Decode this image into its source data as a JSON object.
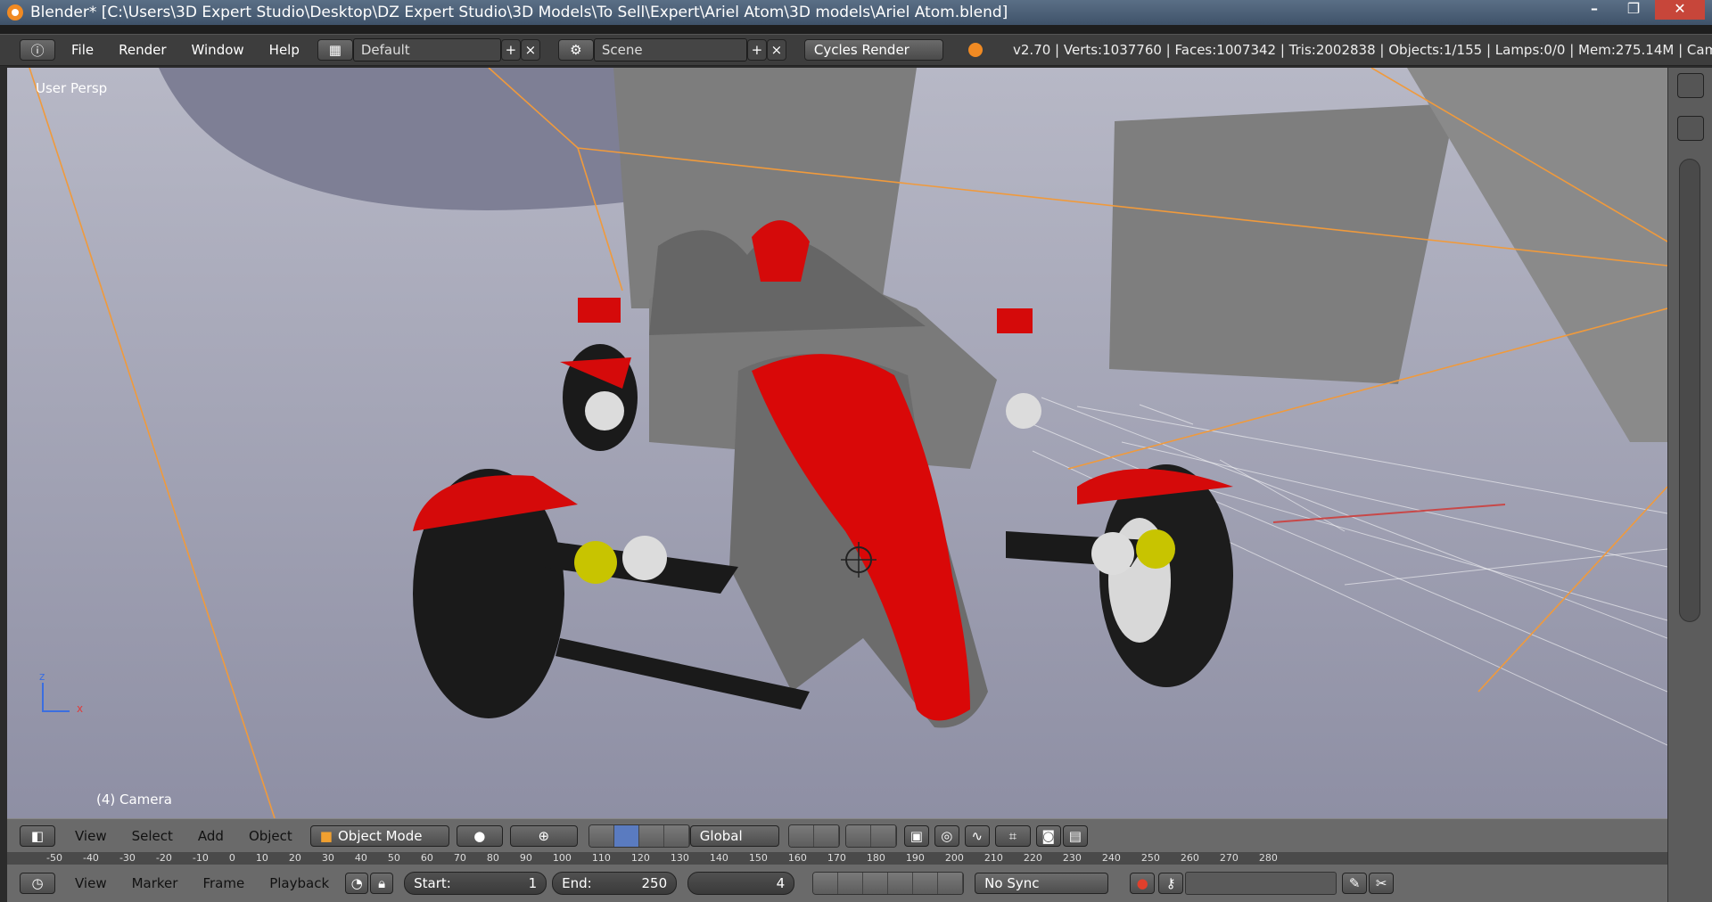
{
  "window": {
    "title": "Blender* [C:\\Users\\3D Expert Studio\\Desktop\\DZ Expert Studio\\3D Models\\To Sell\\Expert\\Ariel Atom\\3D models\\Ariel Atom.blend]",
    "min": "–",
    "max": "❐",
    "close": "✕"
  },
  "info_header": {
    "menus": [
      "File",
      "Render",
      "Window",
      "Help"
    ],
    "layout": "Default",
    "scene": "Scene",
    "engine": "Cycles Render",
    "stats": "v2.70 | Verts:1037760 | Faces:1007342 | Tris:2002838 | Objects:1/155 | Lamps:0/0 | Mem:275.14M | Came",
    "add": "+",
    "remove": "×"
  },
  "viewport": {
    "view_name": "User Persp",
    "active_object": "(4) Camera",
    "axis_z": "z",
    "axis_x": "x"
  },
  "view3d_header": {
    "menus": [
      "View",
      "Select",
      "Add",
      "Object"
    ],
    "mode": "Object Mode",
    "orientation": "Global"
  },
  "ruler_ticks": [
    "-50",
    "-40",
    "-30",
    "-20",
    "-10",
    "0",
    "10",
    "20",
    "30",
    "40",
    "50",
    "60",
    "70",
    "80",
    "90",
    "100",
    "110",
    "120",
    "130",
    "140",
    "150",
    "160",
    "170",
    "180",
    "190",
    "200",
    "210",
    "220",
    "230",
    "240",
    "250",
    "260",
    "270",
    "280"
  ],
  "timeline": {
    "menus": [
      "View",
      "Marker",
      "Frame",
      "Playback"
    ],
    "start_label": "Start:",
    "start": "1",
    "end_label": "End:",
    "end": "250",
    "current": "4",
    "sync": "No Sync"
  },
  "colors": {
    "accent": "#f08a23",
    "car_red": "#d90808",
    "header": "#3d3d3d",
    "viewport": "#9c9db0"
  }
}
